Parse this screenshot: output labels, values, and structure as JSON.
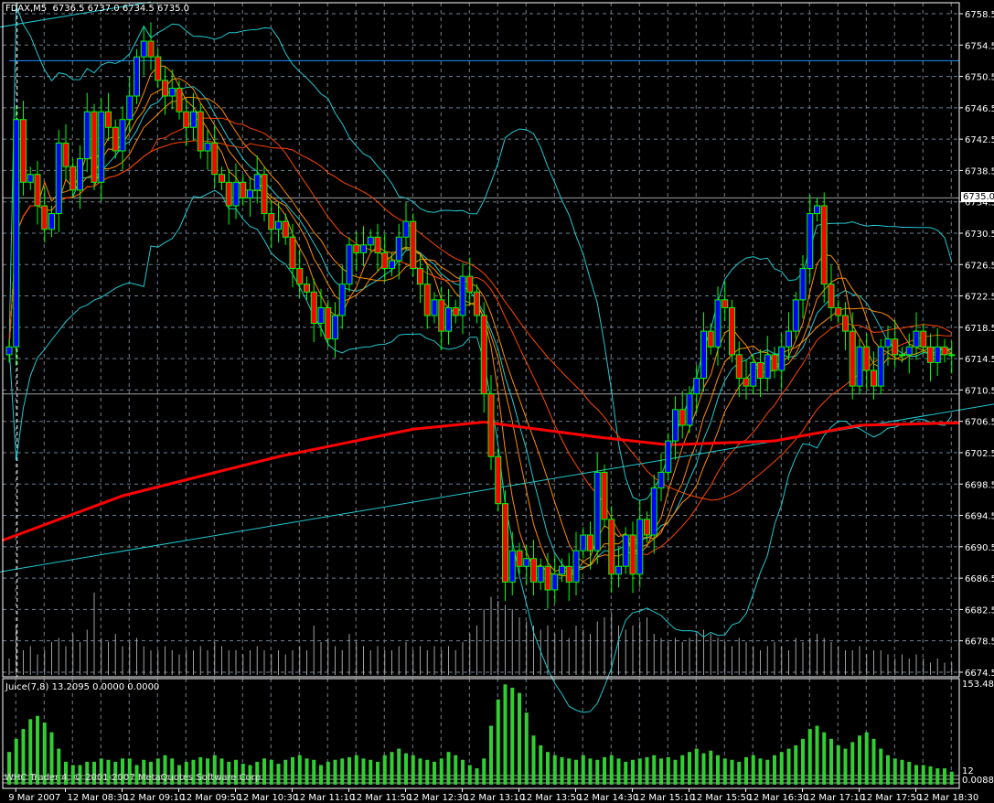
{
  "header": {
    "symbol": "FDAX,M5",
    "ohlc": "6736.5 6737.0 6734.5 6735.0"
  },
  "indicator": {
    "label": "Juice(7,8) 13.2095 0.0000 0.0000",
    "max_label": "153.484",
    "level_label": "12",
    "min_label": "0.0088"
  },
  "watermark": "WHC Trader 4, © 2001-2007 MetaQuotes Software Corp.",
  "current_price_label": "6735.0",
  "colors": {
    "bull": "#0000ff",
    "bear": "#ff0000",
    "outline": "#00ff00",
    "bands": "#20c8d0",
    "ma": "#ff8c00",
    "ma_slow": "#ff4500",
    "ma_long": "#ff0000",
    "grid": "#708090",
    "juice": "#32cd32",
    "volume": "#a0a0a0",
    "level": "#1e90ff"
  },
  "chart_data": {
    "type": "candlestick",
    "title": "FDAX,M5",
    "ylim": [
      6674.5,
      6758.5
    ],
    "yticks": [
      "6758.5",
      "6754.5",
      "6750.5",
      "6746.5",
      "6742.5",
      "6738.5",
      "6734.5",
      "6730.5",
      "6726.5",
      "6722.5",
      "6718.5",
      "6714.5",
      "6710.5",
      "6706.5",
      "6702.5",
      "6698.5",
      "6694.5",
      "6690.5",
      "6686.5",
      "6682.5",
      "6678.5",
      "6674.5"
    ],
    "xticks": [
      {
        "bar": 1,
        "label": "9 Mar 2007"
      },
      {
        "bar": 8,
        "label": "12 Mar 08:30"
      },
      {
        "bar": 16,
        "label": "12 Mar 09:10"
      },
      {
        "bar": 24,
        "label": "12 Mar 09:50"
      },
      {
        "bar": 32,
        "label": "12 Mar 10:30"
      },
      {
        "bar": 40,
        "label": "12 Mar 11:10"
      },
      {
        "bar": 48,
        "label": "12 Mar 11:50"
      },
      {
        "bar": 56,
        "label": "12 Mar 12:30"
      },
      {
        "bar": 64,
        "label": "12 Mar 13:10"
      },
      {
        "bar": 72,
        "label": "12 Mar 13:50"
      },
      {
        "bar": 80,
        "label": "12 Mar 14:30"
      },
      {
        "bar": 88,
        "label": "12 Mar 15:10"
      },
      {
        "bar": 96,
        "label": "12 Mar 15:50"
      },
      {
        "bar": 104,
        "label": "12 Mar 16:30"
      },
      {
        "bar": 112,
        "label": "12 Mar 17:10"
      },
      {
        "bar": 120,
        "label": "12 Mar 17:50"
      },
      {
        "bar": 128,
        "label": "12 Mar 18:30"
      }
    ],
    "close": [
      6716,
      6745,
      6737,
      6738,
      6734,
      6731,
      6733,
      6742,
      6739,
      6736,
      6740,
      6746,
      6737,
      6746,
      6744,
      6741,
      6745,
      6748,
      6753,
      6755,
      6753,
      6750,
      6748,
      6749,
      6746,
      6744,
      6746,
      6741,
      6742,
      6738,
      6737,
      6734,
      6737,
      6735,
      6736,
      6738,
      6733,
      6731,
      6732,
      6730,
      6726,
      6724,
      6723,
      6719,
      6721,
      6717,
      6720,
      6724,
      6729,
      6728,
      6729,
      6730,
      6728,
      6726,
      6727,
      6730,
      6732,
      6726,
      6724,
      6720,
      6722,
      6718,
      6721,
      6720,
      6725,
      6723,
      6720,
      6710,
      6702,
      6696,
      6686,
      6690,
      6688,
      6689,
      6686,
      6688,
      6685,
      6687,
      6688,
      6686,
      6690,
      6692,
      6690,
      6700,
      6694,
      6687,
      6688,
      6692,
      6687,
      6694,
      6692,
      6698,
      6700,
      6704,
      6708,
      6706,
      6710,
      6712,
      6718,
      6716,
      6722,
      6721,
      6715,
      6712,
      6711,
      6714,
      6712,
      6715,
      6713,
      6716,
      6718,
      6722,
      6726,
      6733,
      6734,
      6724,
      6721,
      6720,
      6718,
      6711,
      6716,
      6713,
      6711,
      6716,
      6717,
      6715,
      6715,
      6716,
      6718,
      6716,
      6714,
      6716,
      6715,
      6715
    ],
    "ma_long": [
      [
        -1,
        6691.3
      ],
      [
        16,
        6697
      ],
      [
        38,
        6702
      ],
      [
        57,
        6705.5
      ],
      [
        67,
        6706.4
      ],
      [
        83,
        6704.5
      ],
      [
        93,
        6703.5
      ],
      [
        108,
        6704
      ],
      [
        120,
        6706
      ],
      [
        134,
        6706.3
      ]
    ],
    "trendlines": [
      [
        [
          -1.3,
          6687.3
        ],
        [
          139,
          6708.7
        ]
      ],
      [
        [
          -1.3,
          6756.8
        ],
        [
          20,
          6760
        ]
      ]
    ],
    "hlines": [
      {
        "price": 6752.5,
        "kind": "level"
      },
      {
        "price": 6735.0,
        "kind": "bid"
      },
      {
        "price": 6710.0,
        "kind": "gray"
      }
    ],
    "volume": [
      20,
      60,
      30,
      35,
      25,
      30,
      40,
      45,
      35,
      50,
      40,
      55,
      100,
      45,
      40,
      50,
      35,
      40,
      45,
      35,
      30,
      30,
      35,
      30,
      25,
      30,
      30,
      35,
      30,
      40,
      35,
      30,
      30,
      25,
      30,
      35,
      30,
      25,
      30,
      25,
      30,
      35,
      30,
      60,
      40,
      45,
      35,
      30,
      50,
      40,
      35,
      30,
      35,
      30,
      30,
      35,
      40,
      30,
      35,
      30,
      35,
      30,
      35,
      30,
      40,
      50,
      60,
      80,
      95,
      90,
      85,
      80,
      70,
      65,
      60,
      55,
      60,
      50,
      55,
      45,
      60,
      55,
      50,
      65,
      70,
      75,
      60,
      55,
      60,
      65,
      70,
      50,
      45,
      40,
      45,
      40,
      45,
      50,
      55,
      50,
      45,
      40,
      35,
      45,
      40,
      35,
      30,
      35,
      40,
      35,
      30,
      45,
      40,
      45,
      50,
      45,
      40,
      35,
      30,
      30,
      35,
      25,
      30,
      30,
      25,
      20,
      25,
      20,
      25,
      20,
      15,
      20,
      15,
      15
    ],
    "juice": [
      50,
      70,
      85,
      100,
      105,
      95,
      80,
      55,
      35,
      30,
      30,
      35,
      35,
      40,
      38,
      35,
      40,
      40,
      30,
      38,
      35,
      40,
      45,
      40,
      30,
      35,
      38,
      42,
      40,
      45,
      40,
      35,
      38,
      32,
      30,
      35,
      40,
      38,
      32,
      38,
      42,
      45,
      40,
      38,
      30,
      35,
      38,
      40,
      42,
      45,
      40,
      38,
      35,
      45,
      50,
      55,
      48,
      45,
      40,
      38,
      35,
      40,
      50,
      45,
      38,
      30,
      25,
      40,
      90,
      130,
      153,
      148,
      140,
      110,
      75,
      60,
      50,
      45,
      42,
      40,
      38,
      45,
      40,
      38,
      42,
      45,
      40,
      35,
      38,
      40,
      42,
      45,
      40,
      42,
      38,
      45,
      50,
      55,
      48,
      52,
      45,
      40,
      38,
      35,
      42,
      45,
      40,
      38,
      45,
      50,
      55,
      60,
      70,
      85,
      90,
      80,
      70,
      60,
      55,
      65,
      75,
      80,
      70,
      55,
      45,
      40,
      38,
      35,
      30,
      30,
      28,
      25,
      25,
      20
    ]
  }
}
